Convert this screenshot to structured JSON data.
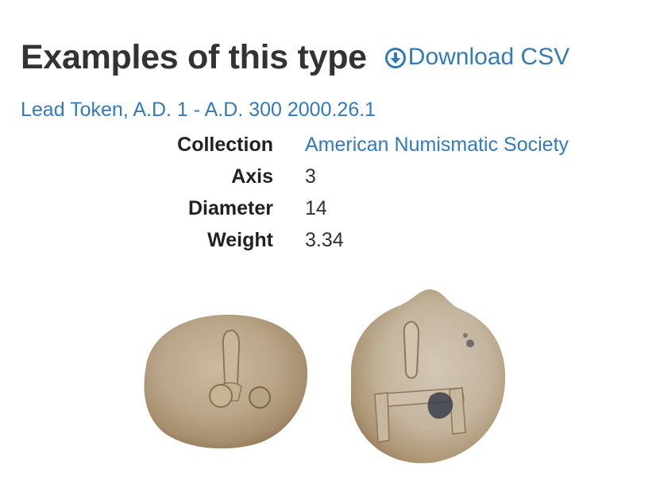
{
  "header": {
    "title": "Examples of this type",
    "download_label": "Download CSV",
    "download_icon": "download-circle-icon"
  },
  "object": {
    "link_text": "Lead Token, A.D. 1 - A.D. 300 2000.26.1",
    "properties": [
      {
        "label": "Collection",
        "value": "American Numismatic Society",
        "is_link": true
      },
      {
        "label": "Axis",
        "value": "3",
        "is_link": false
      },
      {
        "label": "Diameter",
        "value": "14",
        "is_link": false
      },
      {
        "label": "Weight",
        "value": "3.34",
        "is_link": false
      }
    ],
    "images": {
      "obverse": "coin-obverse-image",
      "reverse": "coin-reverse-image"
    }
  },
  "colors": {
    "link": "#337ab7",
    "text": "#333333",
    "coin_base": "#b9a58c"
  }
}
